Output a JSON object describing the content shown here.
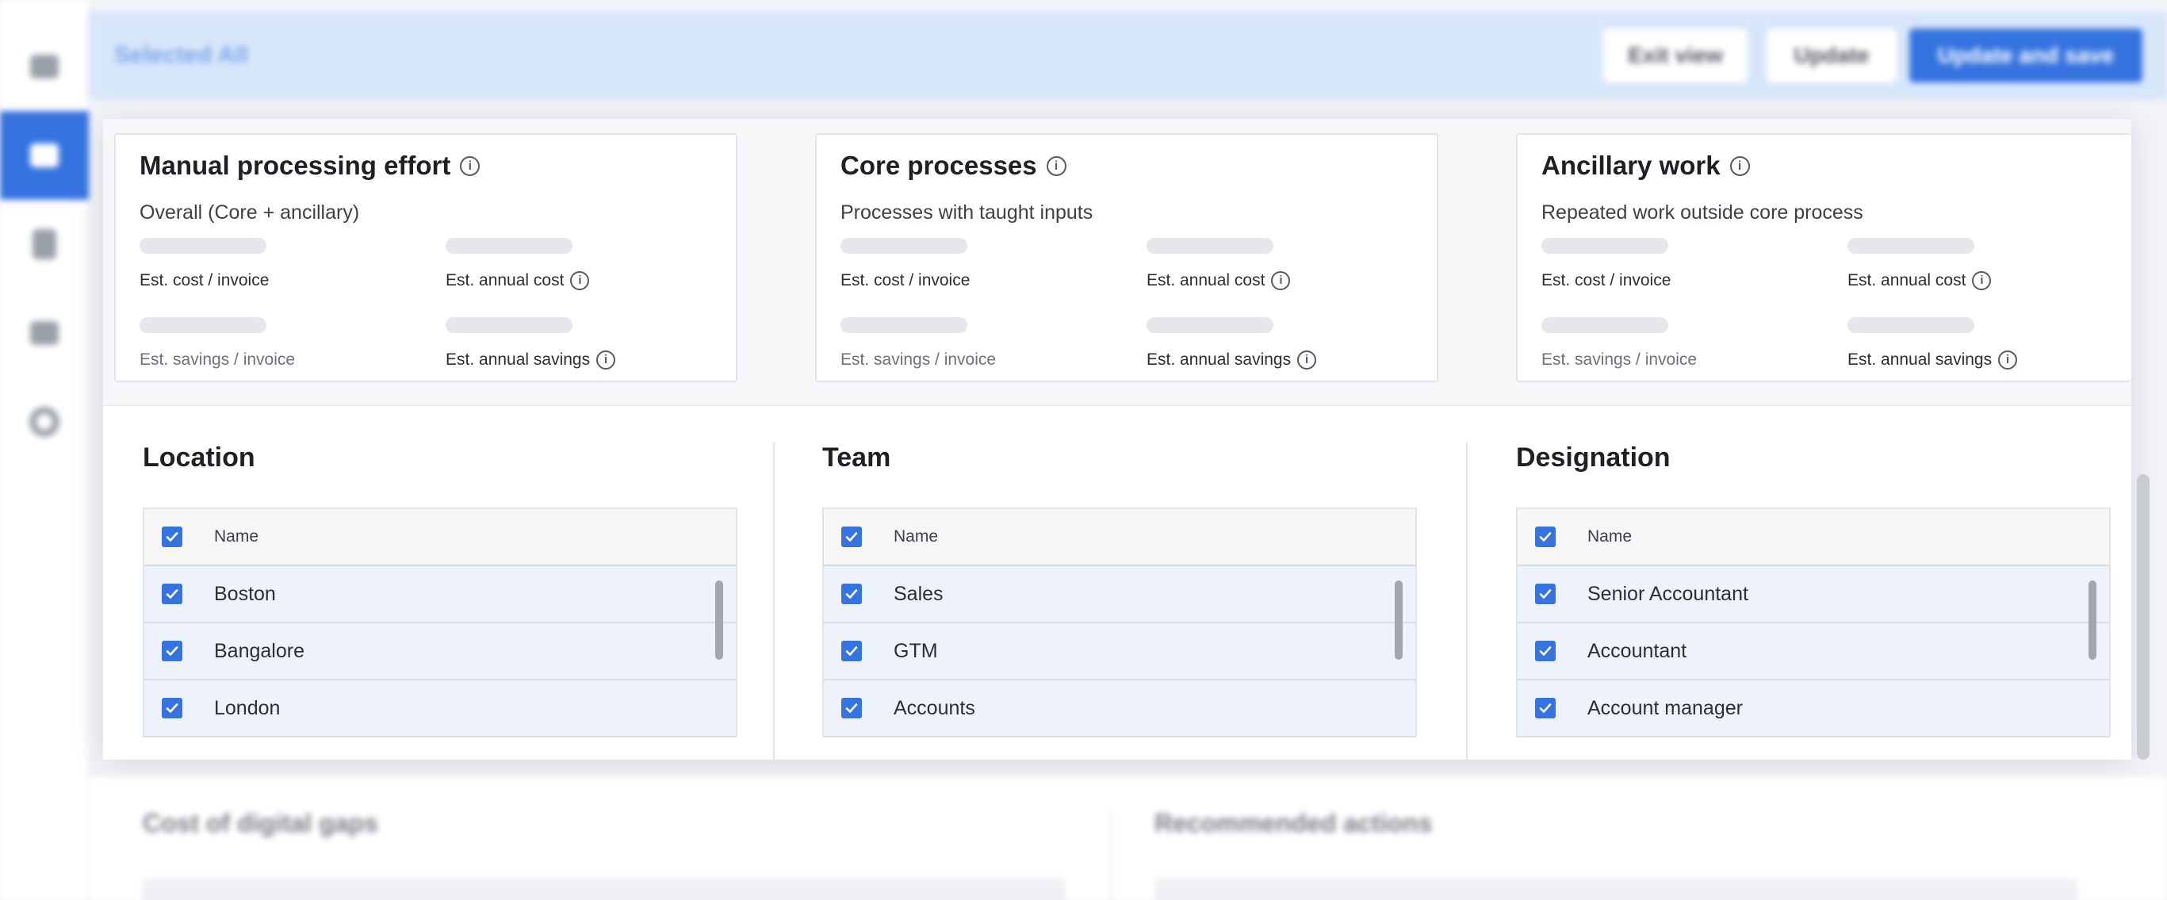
{
  "topbar": {
    "title": "Selected All",
    "exit_label": "Exit view",
    "update_label": "Update",
    "update_save_label": "Update and save"
  },
  "sidebar": {
    "items": [
      {
        "icon": "card-icon",
        "active": false
      },
      {
        "icon": "dashboard-icon",
        "active": true
      },
      {
        "icon": "document-icon",
        "active": false
      },
      {
        "icon": "grid-icon",
        "active": false
      },
      {
        "icon": "gear-icon",
        "active": false
      }
    ]
  },
  "cards": [
    {
      "title": "Manual processing effort",
      "subtitle": "Overall (Core + ancillary)",
      "labels": {
        "cost_invoice": "Est. cost / invoice",
        "annual_cost": "Est. annual cost",
        "savings_invoice": "Est. savings / invoice",
        "annual_savings": "Est. annual savings"
      }
    },
    {
      "title": "Core processes",
      "subtitle": "Processes with taught inputs",
      "labels": {
        "cost_invoice": "Est. cost / invoice",
        "annual_cost": "Est. annual cost",
        "savings_invoice": "Est. savings / invoice",
        "annual_savings": "Est. annual savings"
      }
    },
    {
      "title": "Ancillary work",
      "subtitle": "Repeated work outside core process",
      "labels": {
        "cost_invoice": "Est. cost / invoice",
        "annual_cost": "Est. annual cost",
        "savings_invoice": "Est. savings / invoice",
        "annual_savings": "Est. annual savings"
      }
    }
  ],
  "filters": [
    {
      "title": "Location",
      "header": "Name",
      "items": [
        "Boston",
        "Bangalore",
        "London"
      ]
    },
    {
      "title": "Team",
      "header": "Name",
      "items": [
        "Sales",
        "GTM",
        "Accounts"
      ]
    },
    {
      "title": "Designation",
      "header": "Name",
      "items": [
        "Senior Accountant",
        "Accountant",
        "Account manager"
      ]
    }
  ],
  "bottom": {
    "left_title": "Cost of digital gaps",
    "right_title": "Recommended actions"
  },
  "colors": {
    "accent": "#3573e0",
    "topbar_bg": "#d8e6fa",
    "row_selected_bg": "#edf2fb"
  }
}
